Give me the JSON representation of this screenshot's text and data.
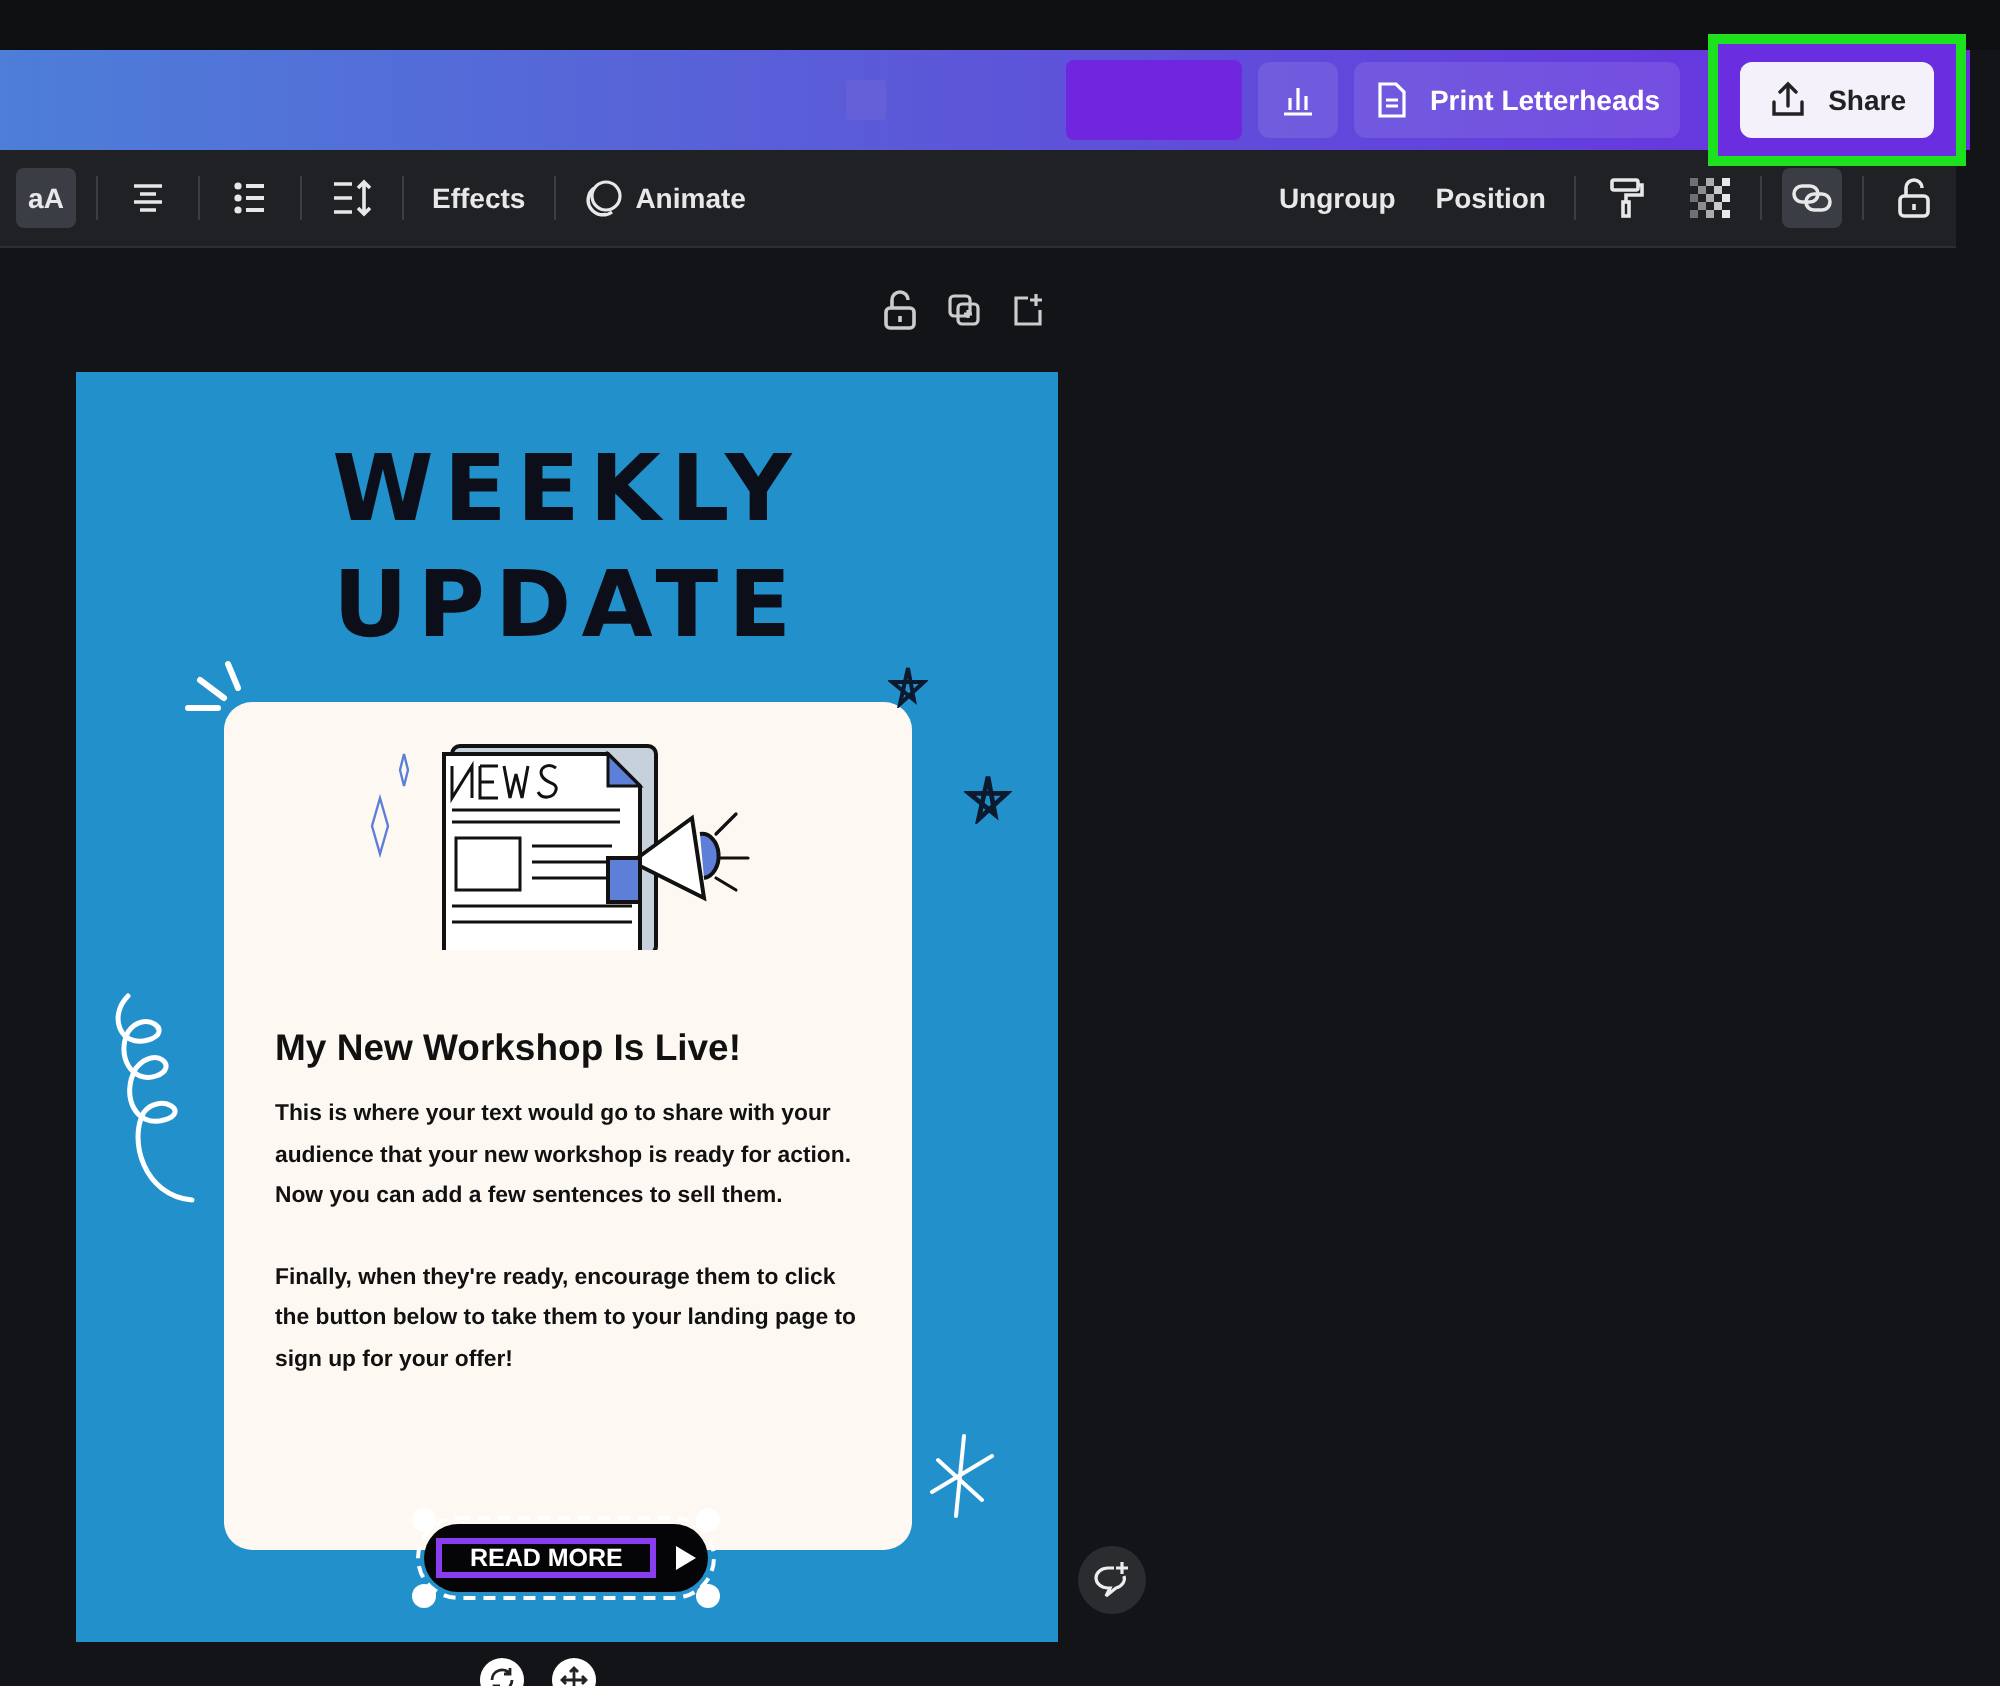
{
  "top_bar": {
    "buttons": [
      {
        "kind": "chart"
      },
      {
        "kind": "doc",
        "label": "Print Letterheads"
      }
    ],
    "share": {
      "label": "Share",
      "highlighted": true
    }
  },
  "toolbar": {
    "left": [
      {
        "kind": "text",
        "label": "aA",
        "selected": true
      },
      {
        "kind": "align",
        "selected": false
      },
      {
        "kind": "list",
        "selected": false
      },
      {
        "kind": "spacing",
        "selected": false
      },
      {
        "kind": "text",
        "label": "Effects",
        "selected": false
      },
      {
        "kind": "animate",
        "label": "Animate",
        "selected": false
      }
    ],
    "right": [
      {
        "kind": "text",
        "label": "Ungroup",
        "selected": false
      },
      {
        "kind": "text",
        "label": "Position",
        "selected": false
      },
      {
        "kind": "roller",
        "selected": false
      },
      {
        "kind": "checker",
        "selected": false
      },
      {
        "kind": "link",
        "selected": true
      },
      {
        "kind": "lock",
        "selected": false
      }
    ]
  },
  "design": {
    "title_lines": [
      "WEEKLY",
      "UPDATE"
    ],
    "card": {
      "heading": "My New Workshop Is Live!",
      "paragraphs": [
        "This is where your text would go to share with your audience that your new workshop is ready for action. Now you can add a few sentences to sell them.",
        "Finally, when they're ready, encourage them to click the button below to take them to your landing page to sign up for your offer!"
      ]
    },
    "button": {
      "label": "READ MORE",
      "selected": true
    }
  }
}
